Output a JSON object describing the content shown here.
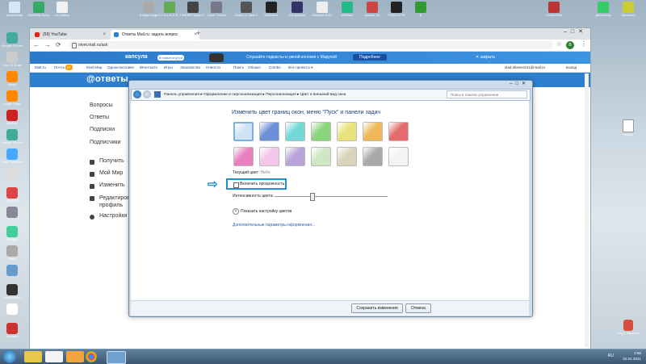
{
  "desktop": {
    "top_icons": [
      "Компьютер",
      "ОКЕАНА Блок Пит",
      "no_rutkey",
      "",
      "Бойцы Кадр",
      "S.T.A.L.K.E.R. Зов Припяти",
      "КВОВР Вира ЛП",
      "Cyber Hunter",
      "World of Tank VE",
      "Warframe",
      "CS warface",
      "Warface.EUC",
      "Warface",
      "Шмель 2Ч",
      "PUBG LITE",
      "B",
      "",
      "",
      "",
      "ScreenPad",
      "Диспетчер",
      "Протокол"
    ],
    "left_icons": [
      "Google Chrome",
      "Corel & Draw",
      "Avast",
      "Avast Clean",
      "Vectron",
      "Google Chrome",
      "Ram Optimizer",
      "",
      "Qtip 2.0",
      "",
      "Google",
      "Pubg",
      "",
      "Настройки",
      "",
      "Корзина"
    ],
    "right_icons": [
      "Ярлык",
      "Ноут. Корзина"
    ]
  },
  "browser": {
    "tabs": [
      {
        "label": "(59) YouTube",
        "active": false
      },
      {
        "label": "Ответы Mail.ru: задать вопрос",
        "active": true
      }
    ],
    "new_tab": "+",
    "nav": {
      "back": "←",
      "forward": "→",
      "reload": "⟳"
    },
    "url": "otvet.mail.ru/ask",
    "star": "☆",
    "avatar_letter": "В",
    "menu": "⋮",
    "banner": {
      "brand": "капсула",
      "badge": "● новые внутри",
      "promo": "Слушайте подкасты и умной колонке с Марусей",
      "cta": "Подробнее",
      "close": "✕ закрыть"
    },
    "mailnav": [
      "Mail.ru",
      "Почта",
      "Мой Мир",
      "Одноклассники",
      "ВКонтакте",
      "Игры",
      "Знакомства",
      "Новости",
      "Поиск",
      "Облако",
      "Combo",
      "Все проекты ▾"
    ],
    "mail_badge": "9+",
    "user": "vlad.eliseev231@mail.ru",
    "logout": "выход",
    "site_logo": "@ответы",
    "left_nav": [
      "Вопросы",
      "Ответы",
      "Подписки",
      "Подписчики"
    ],
    "left_nav2": [
      "Получить",
      "Мой Мир",
      "Изменить",
      "Редактировать профиль",
      "Настройки"
    ]
  },
  "dialog": {
    "breadcrumb": "Панель управления ▸ Оформление и персонализация ▸ Персонализация ▸ Цвет и внешний вид окна",
    "search_placeholder": "Поиск в панели управления",
    "heading": "Изменить цвет границ окон, меню \"Пуск\" и панели задач",
    "swatch_colors_row1": [
      "#cfe2f6",
      "#6b8fd6",
      "#74d9d6",
      "#8ad47b",
      "#e8e27a",
      "#f0b85a",
      "#e46c6c"
    ],
    "swatch_colors_row2": [
      "#e97fc0",
      "#f3c6ea",
      "#b9a3d8",
      "#cfe6c2",
      "#d9d4b8",
      "#a9a9a9",
      "#f3f3f3"
    ],
    "current_color_label": "Текущий цвет:",
    "current_color_value": "Небо",
    "transparency_label": "Включить прозрачность",
    "intensity_label": "Интенсивность цвета:",
    "intensity_level": 0.33,
    "show_mixer": "Показать настройку цветов",
    "advanced_link": "Дополнительные параметры оформления...",
    "save_button": "Сохранить изменения",
    "cancel_button": "Отмена"
  },
  "taskbar": {
    "time": "2:56",
    "date": "02.01.2021",
    "lang": "RU"
  }
}
